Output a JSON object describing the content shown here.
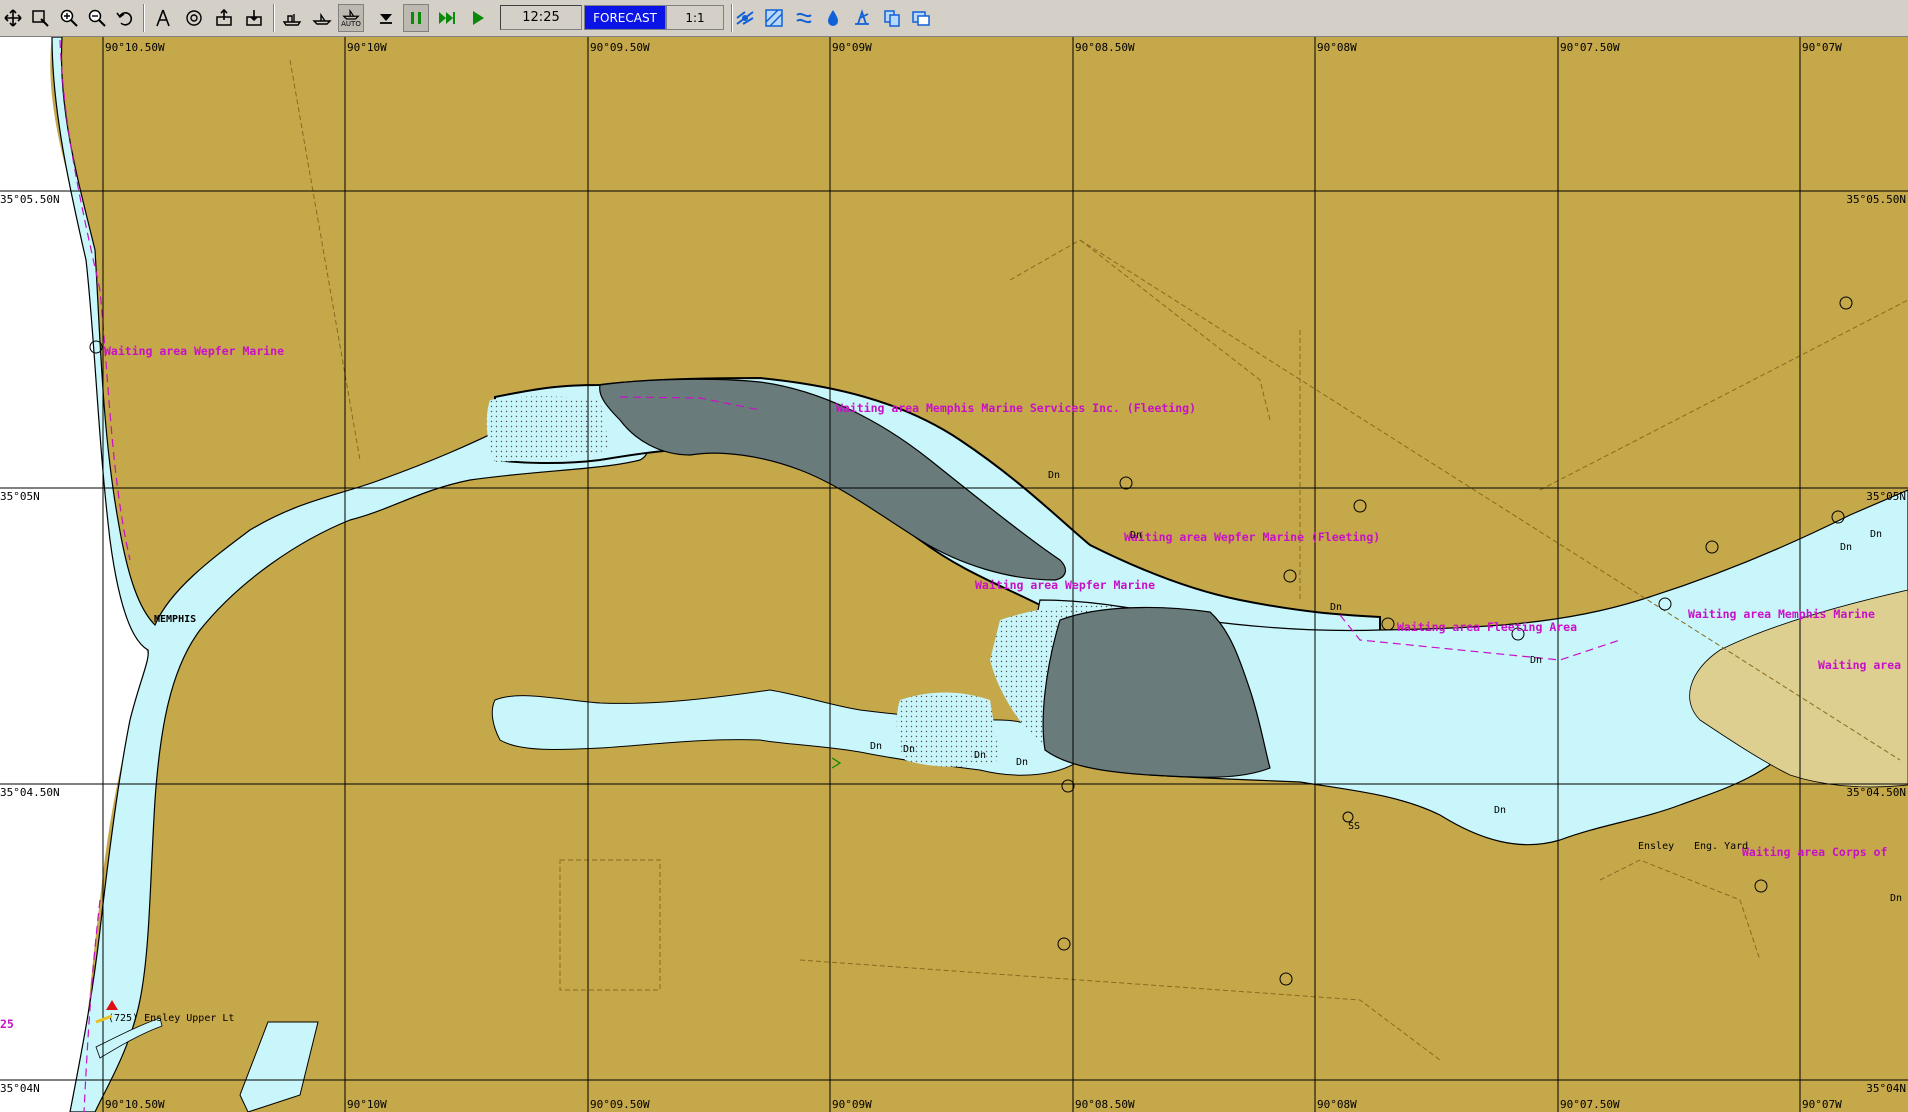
{
  "toolbar": {
    "icons": [
      "pan-icon",
      "select-icon",
      "zoom-in-icon",
      "zoom-out-icon",
      "undo-icon",
      "compass-icon",
      "target-icon",
      "export-icon",
      "import-icon",
      "route-icon",
      "ship-icon",
      "auto-icon",
      "dropdown-icon",
      "pause-icon",
      "fast-forward-icon",
      "play-icon"
    ],
    "auto_label": "AUTO",
    "time": "12:25",
    "forecast_label": "FORECAST",
    "scale": "1:1",
    "right_icons": [
      "layers-icon",
      "grid-icon",
      "current-icon",
      "depth-icon",
      "weather-icon",
      "copy-icon",
      "window-icon"
    ]
  },
  "grid": {
    "lon_labels": [
      "90°10.50W",
      "90°10W",
      "90°09.50W",
      "90°09W",
      "90°08.50W",
      "90°08W",
      "90°07.50W",
      "90°07W"
    ],
    "lat_labels": [
      "35°05.50N",
      "35°05N",
      "35°04.50N",
      "35°04N"
    ]
  },
  "labels": {
    "waiting_wepfer_top": "Waiting area Wepfer Marine",
    "waiting_memphis_services": "Waiting area Memphis Marine Services Inc. (Fleeting)",
    "waiting_wepfer_fleeting": "Waiting area Wepfer Marine (Fleeting)",
    "waiting_wepfer_mid": "Waiting area Wepfer Marine",
    "waiting_fleeting_area": "Waiting area Fleeting Area",
    "waiting_memphis_marine": "Waiting area Memphis Marine",
    "waiting_area_right": "Waiting area",
    "waiting_corps": "Waiting area Corps of",
    "memphis": "MEMPHIS",
    "ensley_light": "(725) Ensley Upper Lt",
    "eng_yard": "Eng. Yard",
    "ensley": "Ensley",
    "ss": "SS",
    "left_edge": "25",
    "dn": "Dn"
  },
  "colors": {
    "land": "#c5a84a",
    "water": "#c8f6fa",
    "dry_bank": "#6a7b7b",
    "sand": "#dccf8f",
    "magenta": "#c810c8"
  }
}
